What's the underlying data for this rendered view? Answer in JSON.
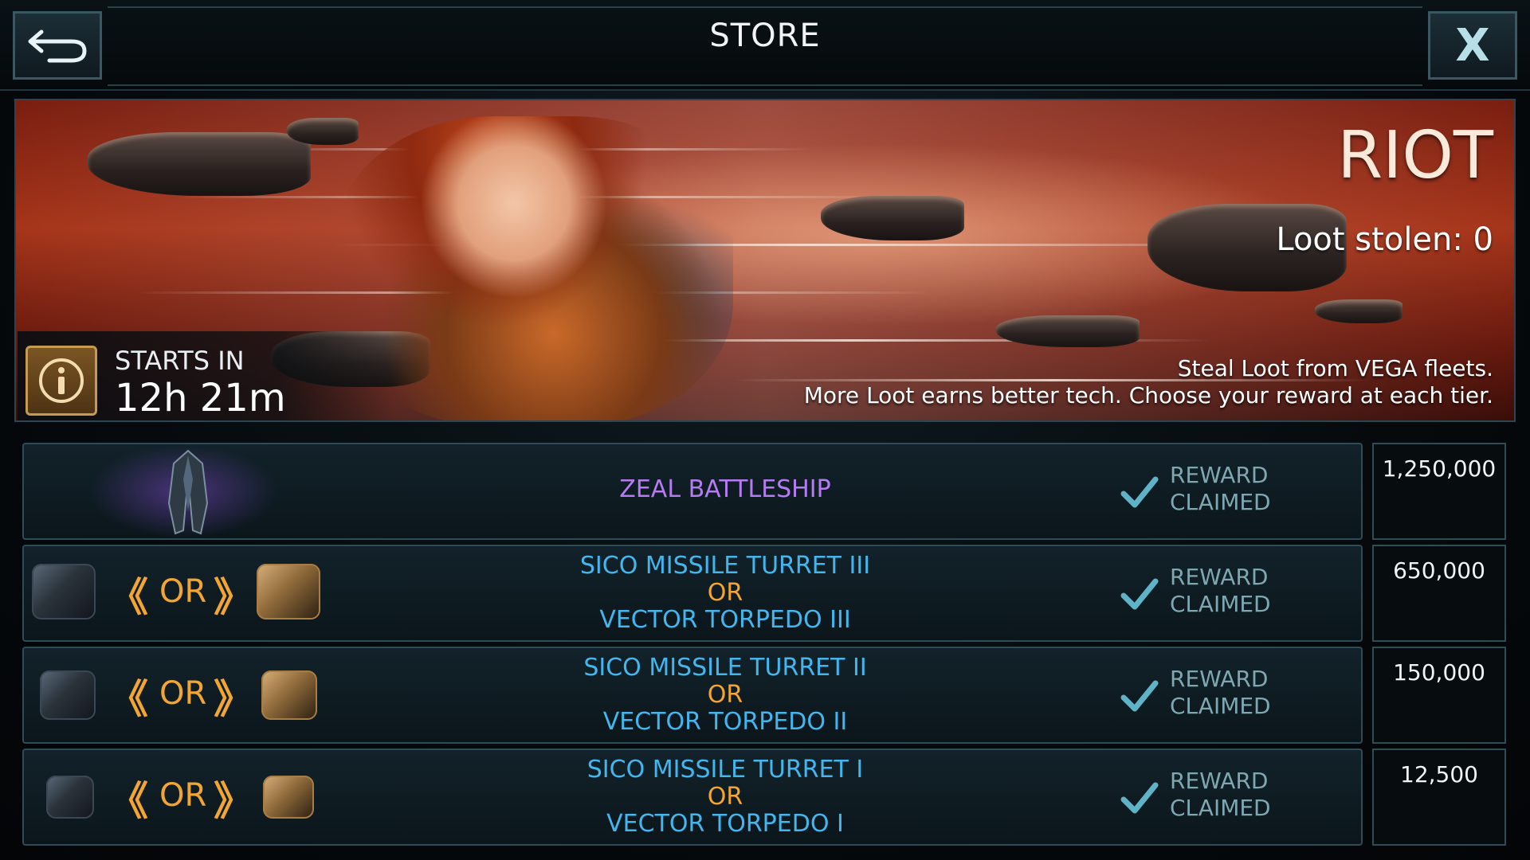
{
  "header": {
    "title": "STORE",
    "back_icon": "back-arrow-icon",
    "close_label": "X"
  },
  "event": {
    "name": "RIOT",
    "loot_line": "Loot stolen: 0",
    "description_line1": "Steal Loot from VEGA fleets.",
    "description_line2": "More Loot earns better tech. Choose your reward at each tier.",
    "starts_label": "STARTS IN",
    "starts_value": "12h 21m"
  },
  "rewards": [
    {
      "name": "ZEAL BATTLESHIP",
      "status_line1": "REWARD",
      "status_line2": "CLAIMED",
      "threshold": "1,250,000"
    },
    {
      "option_a": "SICO MISSILE TURRET III",
      "or_label": "OR",
      "option_b": "VECTOR TORPEDO III",
      "chooser_or": "OR",
      "status_line1": "REWARD",
      "status_line2": "CLAIMED",
      "threshold": "650,000"
    },
    {
      "option_a": "SICO MISSILE TURRET II",
      "or_label": "OR",
      "option_b": "VECTOR TORPEDO II",
      "chooser_or": "OR",
      "status_line1": "REWARD",
      "status_line2": "CLAIMED",
      "threshold": "150,000"
    },
    {
      "option_a": "SICO MISSILE TURRET I",
      "or_label": "OR",
      "option_b": "VECTOR TORPEDO I",
      "chooser_or": "OR",
      "status_line1": "REWARD",
      "status_line2": "CLAIMED",
      "threshold": "12,500"
    }
  ],
  "colors": {
    "ship_name": "#b57cf2",
    "weapon_name": "#43b6ee",
    "or_accent": "#f2a533",
    "claimed_text": "#7fa7b2",
    "check": "#5fb3c6"
  }
}
